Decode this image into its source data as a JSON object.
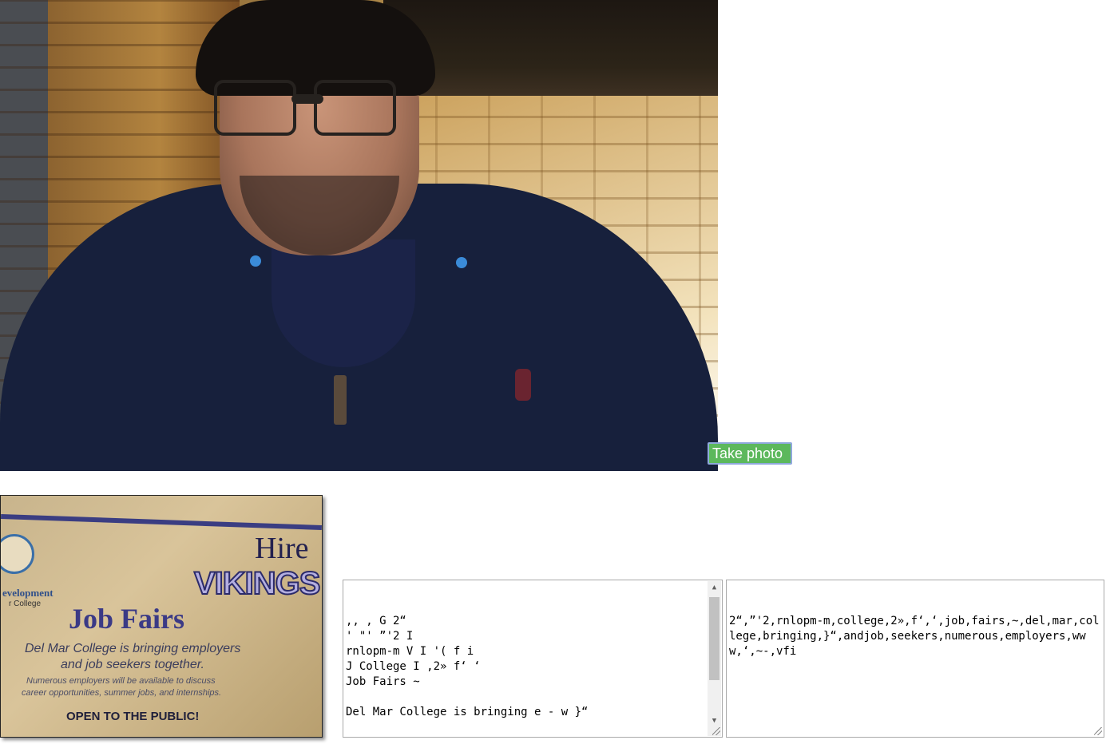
{
  "camera": {
    "take_photo_label": "Take photo"
  },
  "photo": {
    "header": "Hire",
    "brand": "VIKINGS",
    "dept_fragment": "evelopment",
    "college_fragment": "r College",
    "title": "Job Fairs",
    "tagline_line1": "Del Mar College is bringing employers",
    "tagline_line2": "and job seekers together.",
    "detail_line1": "Numerous employers will be available to discuss",
    "detail_line2": "career opportunities, summer jobs, and internships.",
    "cta": "OPEN TO THE PUBLIC!"
  },
  "ocr_output": {
    "text": ",, , G 2“\n' \"' ”'2 I\nrnlopm-m V I '( f i\nJ College I ,2» f‘ ‘\nJob Fairs ~\n\nDel Mar College is bringing e - w }“\n\nandjob seekers together.\nNumerous employers will be available to K"
  },
  "keywords_output": {
    "text": "2“,”'2,rnlopm-m,college,2»,f‘,‘,job,fairs,~,del,mar,college,bringing,}“,andjob,seekers,numerous,employers,www,‘,~-,vfi"
  },
  "colors": {
    "button_bg": "#5cb85c",
    "button_border": "#8fa8dc"
  }
}
